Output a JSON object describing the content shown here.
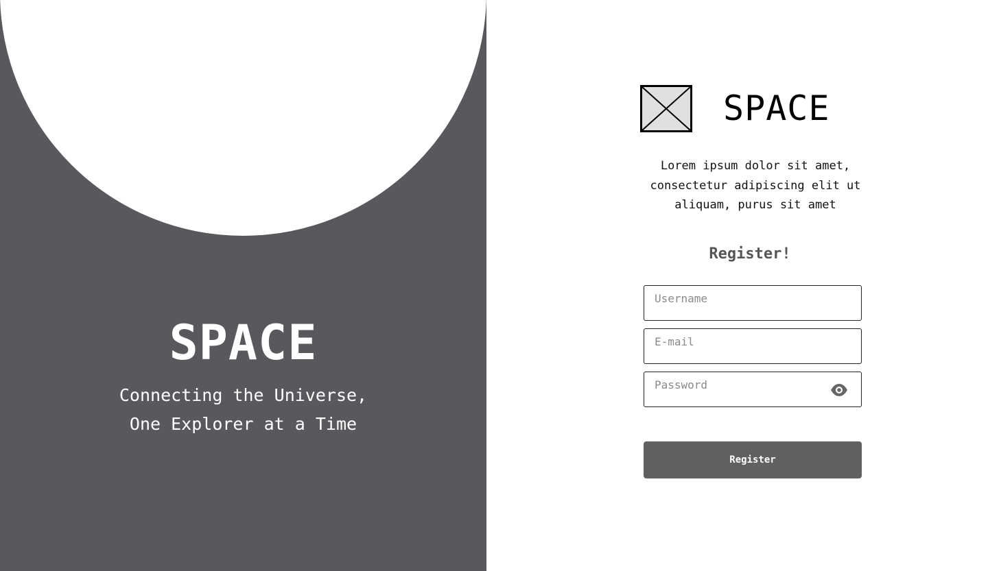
{
  "hero": {
    "title": "SPACE",
    "tagline_line1": "Connecting the Universe,",
    "tagline_line2": "One Explorer at a Time"
  },
  "brand": {
    "logo_icon": "image-placeholder-icon",
    "name": "SPACE"
  },
  "intro": {
    "text": "Lorem ipsum dolor sit amet, consectetur adipiscing elit ut aliquam, purus sit amet"
  },
  "form": {
    "heading": "Register!",
    "username": {
      "value": "",
      "placeholder": "Username"
    },
    "email": {
      "value": "",
      "placeholder": "E-mail"
    },
    "password": {
      "value": "",
      "placeholder": "Password",
      "toggle_icon": "eye-icon"
    },
    "submit_label": "Register"
  },
  "colors": {
    "hero_bg": "#58595d",
    "button_bg": "#606060",
    "heading": "#555555"
  }
}
